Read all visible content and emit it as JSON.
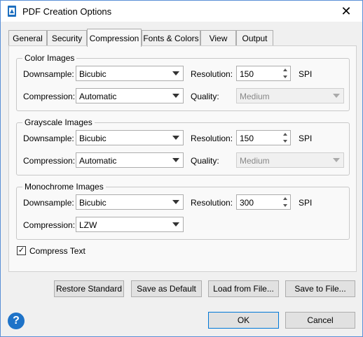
{
  "window": {
    "title": "PDF Creation Options",
    "close_glyph": "✕"
  },
  "tabs": [
    {
      "label": "General"
    },
    {
      "label": "Security"
    },
    {
      "label": "Compression"
    },
    {
      "label": "Fonts & Colors"
    },
    {
      "label": "View"
    },
    {
      "label": "Output"
    }
  ],
  "active_tab": "Compression",
  "sections": {
    "color": {
      "legend": "Color Images",
      "downsample_label": "Downsample:",
      "downsample_value": "Bicubic",
      "resolution_label": "Resolution:",
      "resolution_value": "150",
      "resolution_unit": "SPI",
      "compression_label": "Compression:",
      "compression_value": "Automatic",
      "quality_label": "Quality:",
      "quality_value": "Medium"
    },
    "grayscale": {
      "legend": "Grayscale Images",
      "downsample_label": "Downsample:",
      "downsample_value": "Bicubic",
      "resolution_label": "Resolution:",
      "resolution_value": "150",
      "resolution_unit": "SPI",
      "compression_label": "Compression:",
      "compression_value": "Automatic",
      "quality_label": "Quality:",
      "quality_value": "Medium"
    },
    "mono": {
      "legend": "Monochrome Images",
      "downsample_label": "Downsample:",
      "downsample_value": "Bicubic",
      "resolution_label": "Resolution:",
      "resolution_value": "300",
      "resolution_unit": "SPI",
      "compression_label": "Compression:",
      "compression_value": "LZW"
    }
  },
  "compress_text": {
    "label": "Compress Text",
    "checked": true,
    "check_glyph": "✓"
  },
  "actions": {
    "restore": "Restore Standard",
    "save_default": "Save as Default",
    "load": "Load from File...",
    "save_file": "Save to File..."
  },
  "footer": {
    "ok": "OK",
    "cancel": "Cancel",
    "help_glyph": "?"
  },
  "colors": {
    "accent": "#0078d7",
    "help": "#1e73c8",
    "window_border": "#5a8fd6"
  }
}
